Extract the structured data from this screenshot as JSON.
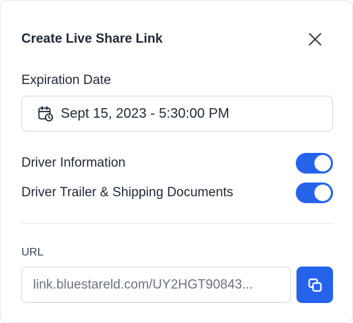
{
  "dialog": {
    "title": "Create Live Share Link"
  },
  "expiration": {
    "label": "Expiration Date",
    "value": "Sept 15, 2023 - 5:30:00 PM",
    "icon": "calendar-clock-icon"
  },
  "toggles": [
    {
      "label": "Driver Information",
      "enabled": true
    },
    {
      "label": "Driver Trailer & Shipping Documents",
      "enabled": true
    }
  ],
  "url": {
    "label": "URL",
    "value": "link.bluestareld.com/UY2HGT90843..."
  },
  "icons": {
    "close": "close-icon",
    "copy": "copy-icon"
  },
  "colors": {
    "accent": "#2563eb",
    "text": "#1f2937",
    "border": "#d1d5db",
    "muted": "#6b7280"
  }
}
